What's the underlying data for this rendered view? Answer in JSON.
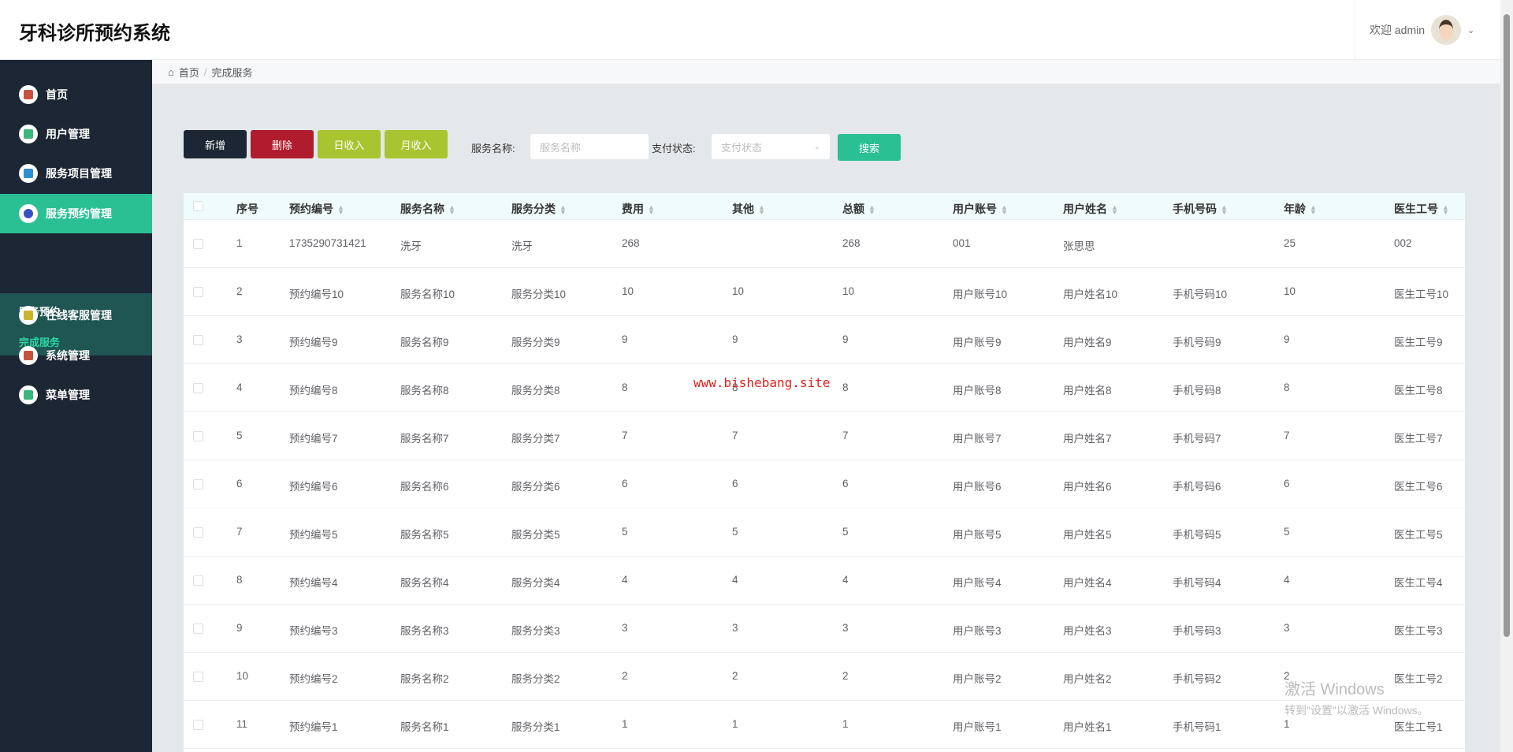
{
  "header": {
    "title": "牙科诊所预约系统",
    "welcome": "欢迎 admin"
  },
  "sidebar": {
    "items": [
      {
        "label": "首页",
        "icon": "home-icon",
        "color": "#c9503f"
      },
      {
        "label": "用户管理",
        "icon": "user-icon",
        "color": "#3cb67a"
      },
      {
        "label": "服务项目管理",
        "icon": "grid-icon",
        "color": "#2f8fd5"
      },
      {
        "label": "服务预约管理",
        "icon": "compass-icon",
        "color": "#3a4fc2"
      },
      {
        "label": "在线客服管理",
        "icon": "chat-icon",
        "color": "#cbb42e"
      },
      {
        "label": "系统管理",
        "icon": "system-icon",
        "color": "#c9503f"
      },
      {
        "label": "菜单管理",
        "icon": "menu-icon",
        "color": "#3cb67a"
      }
    ],
    "sub_items": [
      "服务预约",
      "完成服务"
    ]
  },
  "breadcrumb": [
    "首页",
    "完成服务"
  ],
  "toolbar": {
    "add": "新增",
    "delete": "删除",
    "daily": "日收入",
    "monthly": "月收入",
    "name_label": "服务名称:",
    "name_placeholder": "服务名称",
    "pay_label": "支付状态:",
    "pay_placeholder": "支付状态",
    "search": "搜索"
  },
  "colors": {
    "add": "#1d2634",
    "delete": "#b01c2e",
    "income": "#a8c430",
    "search": "#2bbf94"
  },
  "table": {
    "columns": [
      "序号",
      "预约编号",
      "服务名称",
      "服务分类",
      "费用",
      "其他",
      "总额",
      "用户账号",
      "用户姓名",
      "手机号码",
      "年龄",
      "医生工号"
    ],
    "rows": [
      [
        "1",
        "1735290731421",
        "洗牙",
        "洗牙",
        "268",
        "",
        "268",
        "001",
        "张思思",
        "",
        "25",
        "002"
      ],
      [
        "2",
        "预约编号10",
        "服务名称10",
        "服务分类10",
        "10",
        "10",
        "10",
        "用户账号10",
        "用户姓名10",
        "手机号码10",
        "10",
        "医生工号10"
      ],
      [
        "3",
        "预约编号9",
        "服务名称9",
        "服务分类9",
        "9",
        "9",
        "9",
        "用户账号9",
        "用户姓名9",
        "手机号码9",
        "9",
        "医生工号9"
      ],
      [
        "4",
        "预约编号8",
        "服务名称8",
        "服务分类8",
        "8",
        "8",
        "8",
        "用户账号8",
        "用户姓名8",
        "手机号码8",
        "8",
        "医生工号8"
      ],
      [
        "5",
        "预约编号7",
        "服务名称7",
        "服务分类7",
        "7",
        "7",
        "7",
        "用户账号7",
        "用户姓名7",
        "手机号码7",
        "7",
        "医生工号7"
      ],
      [
        "6",
        "预约编号6",
        "服务名称6",
        "服务分类6",
        "6",
        "6",
        "6",
        "用户账号6",
        "用户姓名6",
        "手机号码6",
        "6",
        "医生工号6"
      ],
      [
        "7",
        "预约编号5",
        "服务名称5",
        "服务分类5",
        "5",
        "5",
        "5",
        "用户账号5",
        "用户姓名5",
        "手机号码5",
        "5",
        "医生工号5"
      ],
      [
        "8",
        "预约编号4",
        "服务名称4",
        "服务分类4",
        "4",
        "4",
        "4",
        "用户账号4",
        "用户姓名4",
        "手机号码4",
        "4",
        "医生工号4"
      ],
      [
        "9",
        "预约编号3",
        "服务名称3",
        "服务分类3",
        "3",
        "3",
        "3",
        "用户账号3",
        "用户姓名3",
        "手机号码3",
        "3",
        "医生工号3"
      ],
      [
        "10",
        "预约编号2",
        "服务名称2",
        "服务分类2",
        "2",
        "2",
        "2",
        "用户账号2",
        "用户姓名2",
        "手机号码2",
        "2",
        "医生工号2"
      ],
      [
        "11",
        "预约编号1",
        "服务名称1",
        "服务分类1",
        "1",
        "1",
        "1",
        "用户账号1",
        "用户姓名1",
        "手机号码1",
        "1",
        "医生工号1"
      ]
    ]
  },
  "watermark": "www.bishebang.site",
  "windows": {
    "line1": "激活 Windows",
    "line2": "转到\"设置\"以激活 Windows。"
  }
}
